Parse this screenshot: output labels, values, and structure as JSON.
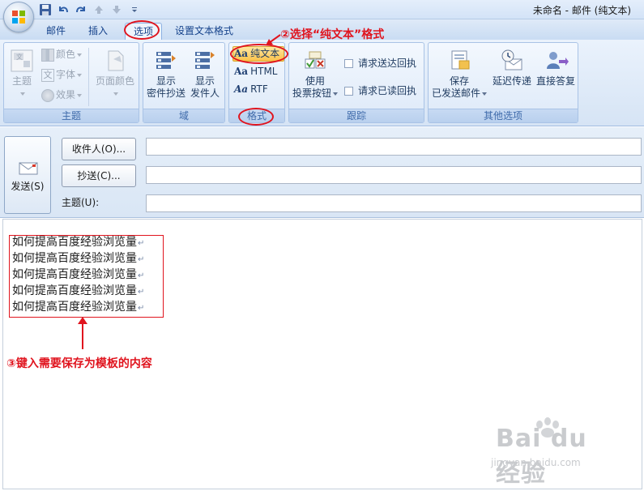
{
  "window": {
    "title": "未命名 - 邮件 (纯文本)"
  },
  "tabs": [
    {
      "label": "邮件"
    },
    {
      "label": "插入"
    },
    {
      "label": "选项"
    },
    {
      "label": "设置文本格式"
    }
  ],
  "annotations": {
    "step2": "②选择“纯文本”格式",
    "step3": "③键入需要保存为模板的内容"
  },
  "ribbon": {
    "theme_group": {
      "label": "主题",
      "theme_button": "主题",
      "colors": "颜色",
      "fonts": "字体",
      "effects": "效果",
      "page_color": "页面颜色"
    },
    "fields_group": {
      "label": "域",
      "show_bcc": [
        "显示",
        "密件抄送"
      ],
      "show_from": [
        "显示",
        "发件人"
      ]
    },
    "format_group": {
      "label": "格式",
      "plain_text": "纯文本",
      "html": "HTML",
      "rtf": "RTF",
      "aa": "Aa"
    },
    "tracking_group": {
      "label": "跟踪",
      "voting": [
        "使用",
        "投票按钮"
      ],
      "delivery_receipt": "请求送达回执",
      "read_receipt": "请求已读回执"
    },
    "more_options_group": {
      "label": "其他选项",
      "save_sent": [
        "保存",
        "已发送邮件"
      ],
      "delay_delivery": "延迟传递",
      "direct_replies": "直接答复"
    }
  },
  "header": {
    "send": "发送(S)",
    "to": "收件人(O)...",
    "cc": "抄送(C)...",
    "subject": "主题(U):",
    "to_value": "",
    "cc_value": "",
    "subject_value": ""
  },
  "body": {
    "lines": [
      "如何提高百度经验浏览量",
      "如何提高百度经验浏览量",
      "如何提高百度经验浏览量",
      "如何提高百度经验浏览量",
      "如何提高百度经验浏览量"
    ],
    "paragraph_mark": "↵"
  },
  "watermark": {
    "brand": "Bai du 经验",
    "url": "jingyan.baidu.com"
  },
  "colors": {
    "annotation_red": "#e0141e",
    "ribbon_blue": "#d6e4f5",
    "selected_orange": "#fcc24a"
  }
}
